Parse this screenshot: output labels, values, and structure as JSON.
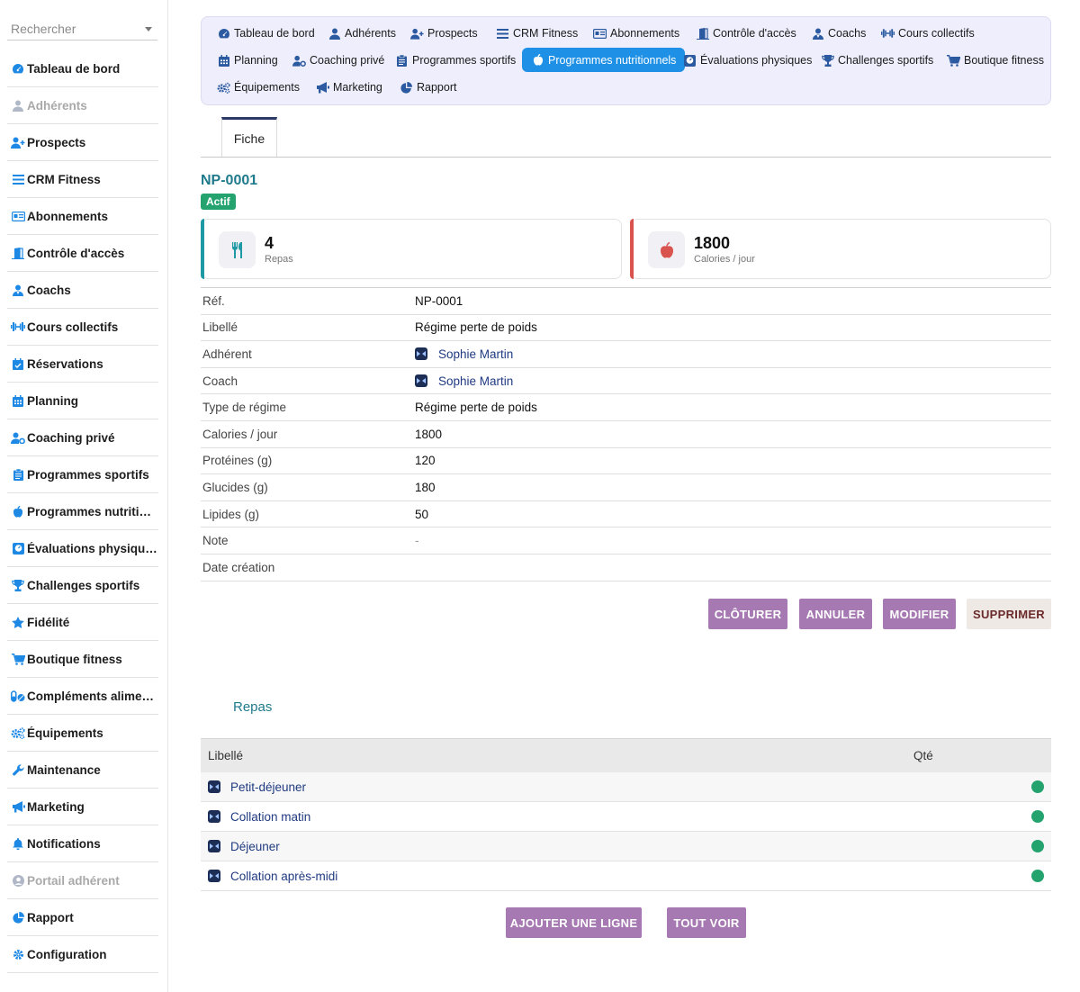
{
  "search": {
    "placeholder": "Rechercher"
  },
  "sidebar": {
    "items": [
      {
        "label": "Tableau de bord",
        "icon": "dashboard-icon",
        "disabled": false
      },
      {
        "label": "Adhérents",
        "icon": "user-icon",
        "disabled": true
      },
      {
        "label": "Prospects",
        "icon": "user-plus-icon",
        "disabled": false
      },
      {
        "label": "CRM Fitness",
        "icon": "bars-icon",
        "disabled": false
      },
      {
        "label": "Abonnements",
        "icon": "id-card-icon",
        "disabled": false
      },
      {
        "label": "Contrôle d'accès",
        "icon": "door-icon",
        "disabled": false
      },
      {
        "label": "Coachs",
        "icon": "coach-icon",
        "disabled": false
      },
      {
        "label": "Cours collectifs",
        "icon": "dumbbell-icon",
        "disabled": false
      },
      {
        "label": "Réservations",
        "icon": "calendar-check-icon",
        "disabled": false
      },
      {
        "label": "Planning",
        "icon": "calendar-icon",
        "disabled": false
      },
      {
        "label": "Coaching privé",
        "icon": "users-cog-icon",
        "disabled": false
      },
      {
        "label": "Programmes sportifs",
        "icon": "clipboard-icon",
        "disabled": false
      },
      {
        "label": "Programmes nutritionnels",
        "icon": "apple-icon",
        "disabled": false
      },
      {
        "label": "Évaluations physiques",
        "icon": "weight-icon",
        "disabled": false
      },
      {
        "label": "Challenges sportifs",
        "icon": "trophy-icon",
        "disabled": false
      },
      {
        "label": "Fidélité",
        "icon": "star-icon",
        "disabled": false
      },
      {
        "label": "Boutique fitness",
        "icon": "cart-icon",
        "disabled": false
      },
      {
        "label": "Compléments alimentaires",
        "icon": "pills-icon",
        "disabled": false
      },
      {
        "label": "Équipements",
        "icon": "cogs-icon",
        "disabled": false
      },
      {
        "label": "Maintenance",
        "icon": "wrench-icon",
        "disabled": false
      },
      {
        "label": "Marketing",
        "icon": "bullhorn-icon",
        "disabled": false
      },
      {
        "label": "Notifications",
        "icon": "bell-icon",
        "disabled": false
      },
      {
        "label": "Portail adhérent",
        "icon": "user-circle-icon",
        "disabled": true
      },
      {
        "label": "Rapport",
        "icon": "pie-chart-icon",
        "disabled": false
      },
      {
        "label": "Configuration",
        "icon": "gear-icon",
        "disabled": false
      }
    ]
  },
  "topnav": {
    "tabs": [
      {
        "label": "Tableau de bord",
        "icon": "dashboard-icon"
      },
      {
        "label": "Adhérents",
        "icon": "user-icon"
      },
      {
        "label": "Prospects",
        "icon": "user-plus-icon"
      },
      {
        "label": "CRM Fitness",
        "icon": "bars-icon"
      },
      {
        "label": "Abonnements",
        "icon": "id-card-icon"
      },
      {
        "label": "Contrôle d'accès",
        "icon": "door-icon"
      },
      {
        "label": "Coachs",
        "icon": "coach-icon"
      },
      {
        "label": "Cours collectifs",
        "icon": "dumbbell-icon"
      },
      {
        "label": "Planning",
        "icon": "calendar-icon"
      },
      {
        "label": "Coaching privé",
        "icon": "users-cog-icon"
      },
      {
        "label": "Programmes sportifs",
        "icon": "clipboard-icon"
      },
      {
        "label": "Programmes nutritionnels",
        "icon": "apple-icon",
        "active": true
      },
      {
        "label": "Évaluations physiques",
        "icon": "weight-icon"
      },
      {
        "label": "Challenges sportifs",
        "icon": "trophy-icon"
      },
      {
        "label": "Boutique fitness",
        "icon": "cart-icon"
      },
      {
        "label": "Équipements",
        "icon": "cogs-icon"
      },
      {
        "label": "Marketing",
        "icon": "bullhorn-icon"
      },
      {
        "label": "Rapport",
        "icon": "pie-chart-icon"
      }
    ]
  },
  "record": {
    "tab": "Fiche",
    "ref": "NP-0001",
    "status": "Actif",
    "stats": [
      {
        "value": "4",
        "caption": "Repas",
        "icon": "utensils-icon",
        "accent": "#1f9aa5"
      },
      {
        "value": "1800",
        "caption": "Calories / jour",
        "icon": "apple-icon",
        "accent": "#d9534f"
      }
    ],
    "fields": [
      {
        "key": "Réf.",
        "value": "NP-0001"
      },
      {
        "key": "Libellé",
        "value": "Régime perte de poids"
      },
      {
        "key": "Adhérent",
        "value": "Sophie Martin",
        "link": true
      },
      {
        "key": "Coach",
        "value": "Sophie Martin",
        "link": true
      },
      {
        "key": "Type de régime",
        "value": "Régime perte de poids"
      },
      {
        "key": "Calories / jour",
        "value": "1800"
      },
      {
        "key": "Protéines (g)",
        "value": "120"
      },
      {
        "key": "Glucides (g)",
        "value": "180"
      },
      {
        "key": "Lipides (g)",
        "value": "50"
      },
      {
        "key": "Note",
        "value": "-",
        "muted": true
      },
      {
        "key": "Date création",
        "value": ""
      }
    ]
  },
  "actions": {
    "close": "CLÔTURER",
    "cancel": "ANNULER",
    "edit": "MODIFIER",
    "delete": "SUPPRIMER"
  },
  "lines": {
    "title": "Repas",
    "col_label": "Libellé",
    "col_qty": "Qté",
    "rows": [
      "Petit-déjeuner",
      "Collation matin",
      "Déjeuner",
      "Collation après-midi"
    ],
    "add": "AJOUTER UNE LIGNE",
    "all": "TOUT VOIR"
  },
  "colors": {
    "accent": "#1e90e6",
    "teal": "#1f7a8c",
    "success": "#25a36f",
    "button": "#a779b2"
  }
}
